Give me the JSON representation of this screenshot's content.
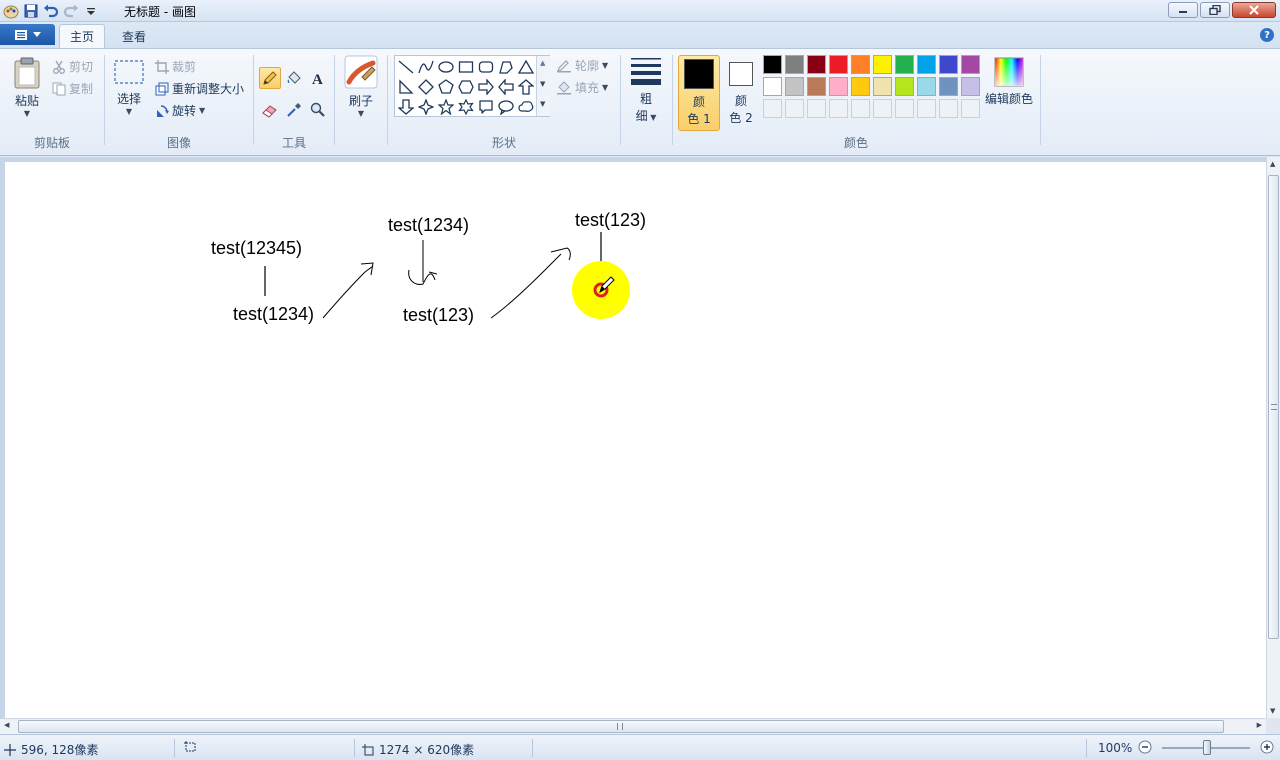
{
  "window": {
    "title": "无标题 - 画图"
  },
  "tabs": [
    {
      "label": "主页"
    },
    {
      "label": "查看"
    }
  ],
  "clipboard": {
    "paste_label": "粘贴",
    "cut_label": "剪切",
    "copy_label": "复制",
    "group_label": "剪贴板"
  },
  "image": {
    "select_label": "选择",
    "crop_label": "裁剪",
    "resize_label": "重新调整大小",
    "rotate_label": "旋转",
    "group_label": "图像"
  },
  "tools": {
    "group_label": "工具",
    "selected_tool": "pencil"
  },
  "brushes": {
    "label": "刷子"
  },
  "shapes": {
    "outline_label": "轮廓",
    "fill_label": "填充",
    "group_label": "形状"
  },
  "size": {
    "label_line1": "粗",
    "label_line2": "细"
  },
  "colors": {
    "color1_line1": "颜",
    "color1_line2": "色 1",
    "color2_line1": "颜",
    "color2_line2": "色 2",
    "color1_value": "#000000",
    "color2_value": "#ffffff",
    "edit_label": "编辑颜色",
    "group_label": "颜色",
    "palette_row1": [
      "#000000",
      "#7f7f7f",
      "#880015",
      "#ed1c24",
      "#ff7f27",
      "#fff200",
      "#22b14c",
      "#00a2e8",
      "#3f48cc",
      "#a349a4"
    ],
    "palette_row2": [
      "#ffffff",
      "#c3c3c3",
      "#b97a57",
      "#ffaec9",
      "#ffc90e",
      "#efe4b0",
      "#b5e61d",
      "#99d9ea",
      "#7092be",
      "#c8bfe7"
    ]
  },
  "canvas": {
    "texts": [
      "test(12345)",
      "test(1234)",
      "test(1234)",
      "test(123)",
      "test(123)"
    ]
  },
  "status": {
    "cursor_pos": "596, 128像素",
    "selection_size": "",
    "image_size": "1274 × 620像素",
    "zoom": "100%"
  }
}
